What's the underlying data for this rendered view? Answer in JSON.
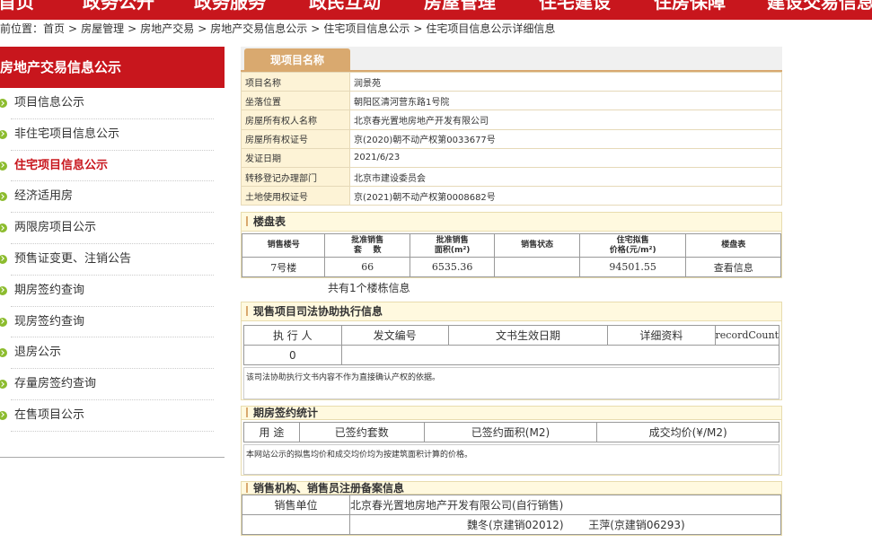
{
  "topnav": [
    "首页",
    "政务公开",
    "政务服务",
    "政民互动",
    "房屋管理",
    "住宅建设",
    "住房保障",
    "建设交易信息"
  ],
  "breadcrumb": {
    "prefix": "当前位置",
    "items": [
      "首页",
      "房屋管理",
      "房地产交易",
      "房地产交易信息公示",
      "住宅项目信息公示",
      "住宅项目信息公示详细信息"
    ]
  },
  "sidebar": {
    "title": "房地产交易信息公示",
    "items": [
      {
        "label": "项目信息公示"
      },
      {
        "label": "非住宅项目信息公示"
      },
      {
        "label": "住宅项目信息公示",
        "active": true
      },
      {
        "label": "经济适用房"
      },
      {
        "label": "两限房项目公示"
      },
      {
        "label": "预售证变更、注销公告"
      },
      {
        "label": "期房签约查询"
      },
      {
        "label": "现房签约查询"
      },
      {
        "label": "退房公示"
      },
      {
        "label": "存量房签约查询"
      },
      {
        "label": "在售项目公示"
      }
    ]
  },
  "project": {
    "tab_label": "现项目名称",
    "rows": [
      {
        "key": "项目名称",
        "value": "润景苑"
      },
      {
        "key": "坐落位置",
        "value": "朝阳区清河营东路1号院"
      },
      {
        "key": "房屋所有权人名称",
        "value": "北京春光置地房地产开发有限公司"
      },
      {
        "key": "房屋所有权证号",
        "value": "京(2020)朝不动产权第0033677号"
      },
      {
        "key": "发证日期",
        "value": "2021/6/23"
      },
      {
        "key": "转移登记办理部门",
        "value": "北京市建设委员会"
      },
      {
        "key": "土地使用权证号",
        "value": "京(2021)朝不动产权第0008682号"
      }
    ]
  },
  "panbiao": {
    "title": "楼盘表",
    "headers": [
      "销售楼号",
      "批准销售\n套    数",
      "批准销售\n面积(m²)",
      "销售状态",
      "住宅拟售\n价格(元/m²)",
      "楼盘表"
    ],
    "rows": [
      [
        "7号楼",
        "66",
        "6535.36",
        "",
        "94501.55",
        "查看信息"
      ]
    ],
    "count_text": "共有1个楼栋信息"
  },
  "judicial": {
    "title": "现售项目司法协助执行信息",
    "headers": [
      "执 行 人",
      "发文编号",
      "文书生效日期",
      "详细资料",
      "recordCount"
    ],
    "row": [
      "0"
    ],
    "note": "该司法协助执行文书内容不作为直接确认产权的依据。"
  },
  "qifang": {
    "title": "期房签约统计",
    "headers": [
      "用 途",
      "已签约套数",
      "已签约面积(M2)",
      "成交均价(¥/M2)"
    ],
    "note": "本网站公示的拟售均价和成交均价均为按建筑面积计算的价格。"
  },
  "agency": {
    "title": "销售机构、销售员注册备案信息",
    "unit_label": "销售单位",
    "unit_value": "北京春光置地房地产开发有限公司(自行销售)",
    "sellers": [
      "魏冬(京建销02012)",
      "王萍(京建销06293)"
    ]
  },
  "colors": {
    "brand_red": "#c8161d",
    "tab_gold": "#d9a96f",
    "bullet_green": "#8cbc2e"
  }
}
